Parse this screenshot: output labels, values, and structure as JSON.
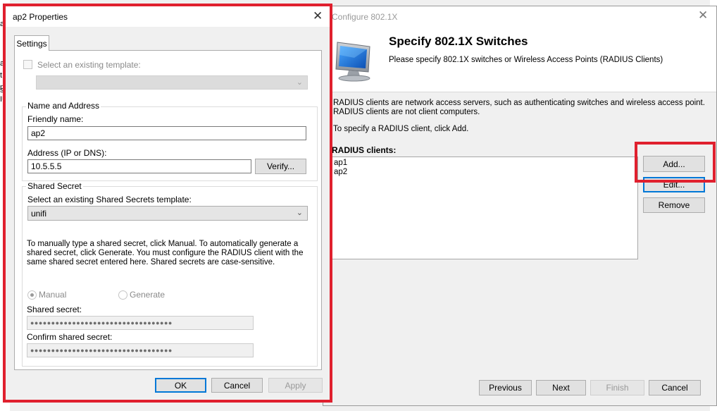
{
  "background_window": {
    "fragments": [
      "a",
      "a",
      "t",
      "n",
      "s",
      "IU"
    ]
  },
  "wizard": {
    "title": "Configure 802.1X",
    "heading": "Specify 802.1X Switches",
    "subheading": "Please specify 802.1X switches or Wireless Access Points (RADIUS Clients)",
    "description_line1": "RADIUS clients are network access servers, such as authenticating switches and wireless access point.",
    "description_line2": "RADIUS clients are not client computers.",
    "description_line3": "To specify a RADIUS client, click Add.",
    "clients_label": "RADIUS clients:",
    "clients": [
      "ap1",
      "ap2"
    ],
    "buttons": {
      "add": "Add...",
      "edit": "Edit...",
      "remove": "Remove",
      "previous": "Previous",
      "next": "Next",
      "finish": "Finish",
      "cancel": "Cancel"
    },
    "close_glyph": "✕"
  },
  "properties": {
    "title": "ap2 Properties",
    "close_glyph": "✕",
    "tab": "Settings",
    "template_checkbox_label": "Select an existing template:",
    "template_value": "",
    "name_group_label": "Name and Address",
    "friendly_name_label": "Friendly name:",
    "friendly_name_value": "ap2",
    "address_label": "Address (IP or DNS):",
    "address_value": "10.5.5.5",
    "verify_button": "Verify...",
    "secret_group_label": "Shared Secret",
    "secret_template_label": "Select an existing Shared Secrets template:",
    "secret_template_value": "unifi",
    "instructions": "To manually type a shared secret, click Manual. To automatically generate a shared secret, click Generate. You must configure the RADIUS client with the same shared secret entered here. Shared secrets are case-sensitive.",
    "radio_manual": "Manual",
    "radio_generate": "Generate",
    "shared_secret_label": "Shared secret:",
    "shared_secret_value": "●●●●●●●●●●●●●●●●●●●●●●●●●●●●●●●●●●",
    "confirm_secret_label": "Confirm shared secret:",
    "confirm_secret_value": "●●●●●●●●●●●●●●●●●●●●●●●●●●●●●●●●●●",
    "ok_button": "OK",
    "cancel_button": "Cancel",
    "apply_button": "Apply"
  },
  "icons": {
    "chevron": "⌵",
    "chevron_down": "⌄"
  },
  "colors": {
    "highlight_red": "#e0202e",
    "focus_blue": "#0078d7"
  }
}
